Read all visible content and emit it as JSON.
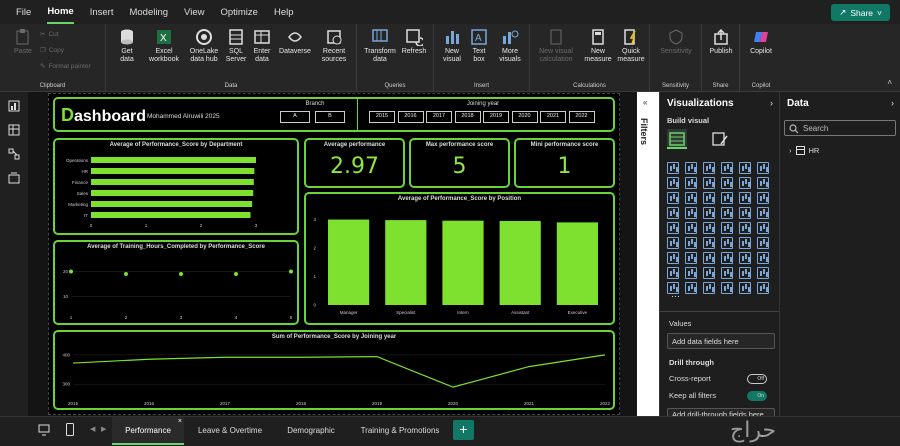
{
  "menubar": {
    "items": [
      "File",
      "Home",
      "Insert",
      "Modeling",
      "View",
      "Optimize",
      "Help"
    ],
    "active": "Home",
    "share_label": "Share"
  },
  "ribbon": {
    "clipboard": {
      "label": "Clipboard",
      "paste": "Paste",
      "cut": "Cut",
      "copy": "Copy",
      "format_painter": "Format painter"
    },
    "data": {
      "label": "Data",
      "get_data": "Get\ndata",
      "excel": "Excel\nworkbook",
      "onelake": "OneLake\ndata hub",
      "sql": "SQL\nServer",
      "enter": "Enter\ndata",
      "dataverse": "Dataverse",
      "recent": "Recent\nsources"
    },
    "queries": {
      "label": "Queries",
      "transform": "Transform\ndata",
      "refresh": "Refresh"
    },
    "insert": {
      "label": "Insert",
      "new_visual": "New\nvisual",
      "text_box": "Text\nbox",
      "more_visuals": "More\nvisuals"
    },
    "calculations": {
      "label": "Calculations",
      "new_visual_calc": "New visual\ncalculation",
      "new_measure": "New\nmeasure",
      "quick_measure": "Quick\nmeasure"
    },
    "sensitivity": {
      "label": "Sensitivity",
      "btn": "Sensitivity"
    },
    "share": {
      "label": "Share",
      "publish": "Publish"
    },
    "copilot": {
      "label": "Copilot",
      "btn": "Copilot"
    }
  },
  "dashboard": {
    "title_first": "D",
    "title_rest": "ashboard",
    "author": "Mohammed Alruwili 2025",
    "branch": {
      "label": "Branch",
      "options": [
        "A",
        "B"
      ]
    },
    "joining_year": {
      "label": "Joining year",
      "years": [
        "2015",
        "2016",
        "2017",
        "2018",
        "2019",
        "2020",
        "2021",
        "2022"
      ]
    },
    "kpis": [
      {
        "label": "Average performance",
        "value": "2.97"
      },
      {
        "label": "Max performance score",
        "value": "5"
      },
      {
        "label": "Mini performance score",
        "value": "1"
      }
    ],
    "accent": "#7ee02f"
  },
  "chart_data": [
    {
      "type": "bar",
      "orientation": "horizontal",
      "title": "Average of Performance_Score by Department",
      "categories": [
        "Operations",
        "HR",
        "Finance",
        "Sales",
        "Marketing",
        "IT"
      ],
      "values": [
        3.0,
        2.97,
        2.96,
        2.95,
        2.93,
        2.9
      ],
      "xticks": [
        "0",
        "1",
        "2",
        "3"
      ],
      "xlim": [
        0,
        3.2
      ]
    },
    {
      "type": "scatter",
      "title": "Average of Training_Hours_Completed by Performance_Score",
      "x": [
        1,
        2,
        3,
        4,
        5
      ],
      "y": [
        20,
        19,
        19,
        19,
        20
      ],
      "xticks": [
        "1",
        "2",
        "3",
        "4",
        "5"
      ],
      "yticks": [
        "10",
        "20"
      ],
      "ylim": [
        5,
        25
      ]
    },
    {
      "type": "bar",
      "title": "Average of Performance_Score by Position",
      "categories": [
        "Manager",
        "Specialist",
        "Intern",
        "Assistant",
        "Executive"
      ],
      "values": [
        3.0,
        2.98,
        2.96,
        2.95,
        2.9
      ],
      "yticks": [
        "0",
        "1",
        "2",
        "3"
      ],
      "ylim": [
        0,
        3.3
      ]
    },
    {
      "type": "line",
      "title": "Sum of Performance_Score by Joining year",
      "x": [
        "2015",
        "2016",
        "2017",
        "2018",
        "2019",
        "2020",
        "2021",
        "2022"
      ],
      "y": [
        372,
        385,
        392,
        392,
        394,
        290,
        360,
        400
      ],
      "yticks": [
        "300",
        "400"
      ],
      "ylim": [
        270,
        420
      ]
    }
  ],
  "filters_label": "Filters",
  "viz_pane": {
    "title": "Visualizations",
    "build_visual": "Build visual",
    "values_label": "Values",
    "values_placeholder": "Add data fields here",
    "drill_label": "Drill through",
    "cross_report": "Cross-report",
    "cross_report_state": "Off",
    "keep_filters": "Keep all filters",
    "keep_filters_state": "On",
    "drill_placeholder": "Add drill-through fields here"
  },
  "data_pane": {
    "title": "Data",
    "search_placeholder": "Search",
    "tables": [
      "HR"
    ]
  },
  "tabs": [
    "Performance",
    "Leave & Overtime",
    "Demographic",
    "Training & Promotions"
  ],
  "active_tab": "Performance",
  "watermark": "حراج"
}
